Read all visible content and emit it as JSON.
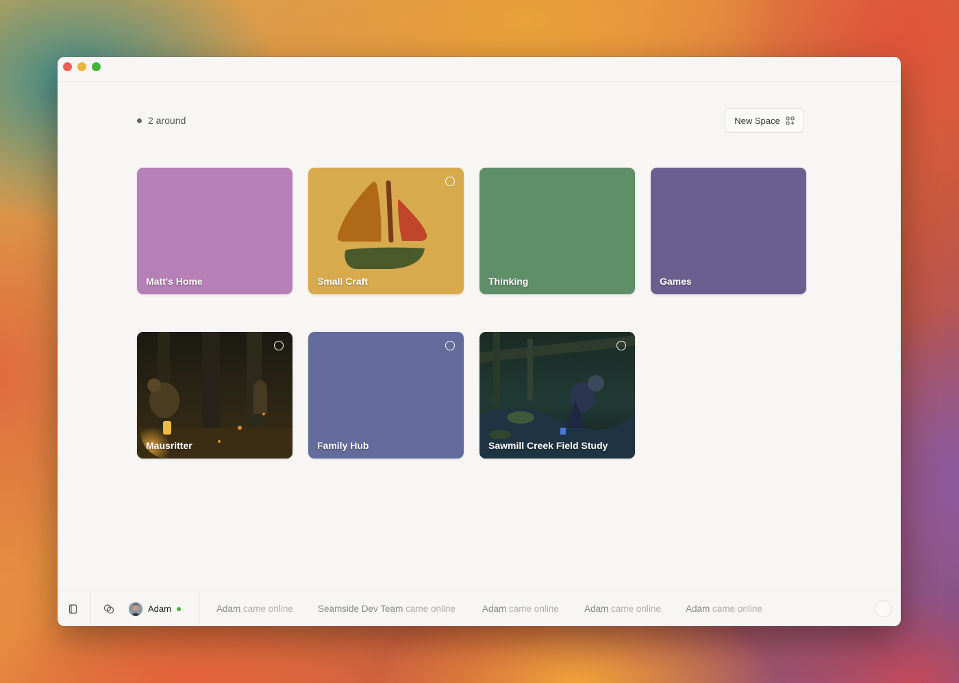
{
  "presence": {
    "text": "2 around"
  },
  "toolbar": {
    "new_space_label": "New Space",
    "new_space_icon": "add-grid-icon"
  },
  "spaces": [
    {
      "name": "Matt's Home",
      "color": "#b67fb5",
      "ring": false
    },
    {
      "name": "Small Craft",
      "color": "#d6aa4d",
      "ring": true,
      "art": "sailboat"
    },
    {
      "name": "Thinking",
      "color": "#5e8f69",
      "ring": false
    },
    {
      "name": "Games",
      "color": "#6b5f8f",
      "ring": false
    },
    {
      "name": "Mausritter",
      "color": "#2a2414",
      "ring": true,
      "art": "dark-forest-mouse"
    },
    {
      "name": "Family Hub",
      "color": "#636c9c",
      "ring": true
    },
    {
      "name": "Sawmill Creek Field Study",
      "color": "#1d2b2c",
      "ring": true,
      "art": "creek-photo"
    }
  ],
  "bottombar": {
    "user_name": "Adam",
    "user_status": "online",
    "activity": [
      {
        "who": "Adam",
        "what": "came online"
      },
      {
        "who": "Seamside Dev Team",
        "what": "came online"
      },
      {
        "who": "Adam",
        "what": "came online"
      },
      {
        "who": "Adam",
        "what": "came online"
      },
      {
        "who": "Adam",
        "what": "came online"
      }
    ]
  }
}
